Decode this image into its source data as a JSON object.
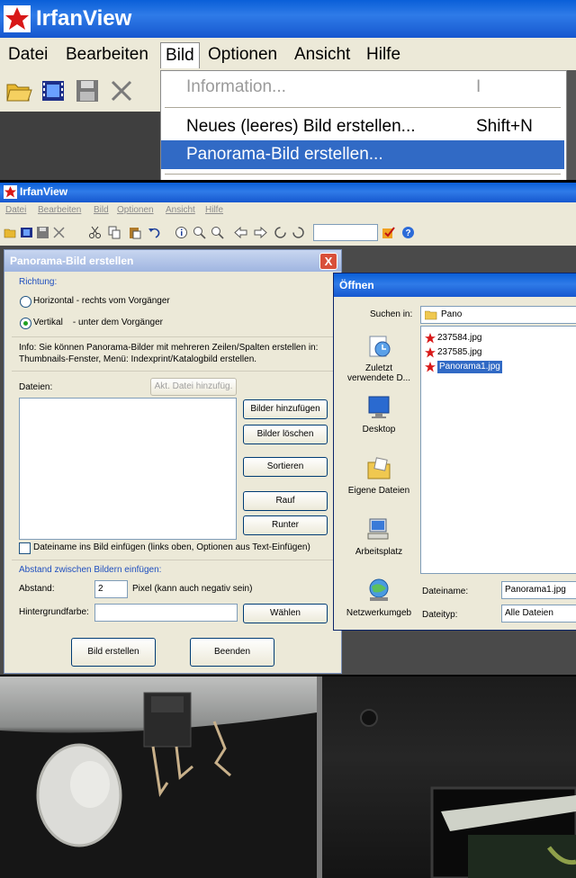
{
  "zoom_panel": {
    "app_title": "IrfanView",
    "menu": [
      "Datei",
      "Bearbeiten",
      "Bild",
      "Optionen",
      "Ansicht",
      "Hilfe"
    ],
    "dropdown": [
      {
        "label": "Information...",
        "shortcut": "I",
        "state": "disabled"
      },
      {
        "label": "Neues (leeres) Bild erstellen...",
        "shortcut": "Shift+N",
        "state": "normal"
      },
      {
        "label": "Panorama-Bild erstellen...",
        "shortcut": "",
        "state": "selected"
      }
    ]
  },
  "main_window": {
    "app_title": "IrfanView",
    "menu": [
      "Datei",
      "Bearbeiten",
      "Bild",
      "Optionen",
      "Ansicht",
      "Hilfe"
    ]
  },
  "panorama_dialog": {
    "title": "Panorama-Bild erstellen",
    "close_label": "X",
    "direction_group": "Richtung:",
    "option_horizontal": "Horizontal - rechts vom Vorgänger",
    "option_vertical": "Vertikal    - unter dem Vorgänger",
    "selected_option": "vertical",
    "info_line1": "Info: Sie können Panorama-Bilder mit mehreren Zeilen/Spalten erstellen in:",
    "info_line2": "Thumbnails-Fenster, Menü: Indexprint/Katalogbild erstellen.",
    "files_label": "Dateien:",
    "add_current_button": "Akt. Datei hinzufüg.",
    "add_images_button": "Bilder hinzufügen",
    "delete_images_button": "Bilder löschen",
    "sort_button": "Sortieren",
    "up_button": "Rauf",
    "down_button": "Runter",
    "filename_checkbox": "Dateiname ins Bild einfügen (links oben, Optionen aus Text-Einfügen)",
    "spacing_group": "Abstand zwischen Bildern einfügen:",
    "spacing_label": "Abstand:",
    "spacing_value": "2",
    "spacing_unit": "Pixel (kann auch negativ sein)",
    "bgcolor_label": "Hintergrundfarbe:",
    "bgcolor_value": "",
    "choose_button": "Wählen",
    "create_button": "Bild erstellen",
    "exit_button": "Beenden"
  },
  "open_dialog": {
    "title": "Öffnen",
    "look_in_label": "Suchen in:",
    "look_in_value": "Pano",
    "places": [
      {
        "label_line1": "Zuletzt",
        "label_line2": "verwendete D...",
        "icon": "recent-documents-icon"
      },
      {
        "label_line1": "Desktop",
        "label_line2": "",
        "icon": "desktop-icon"
      },
      {
        "label_line1": "Eigene Dateien",
        "label_line2": "",
        "icon": "my-documents-icon"
      },
      {
        "label_line1": "Arbeitsplatz",
        "label_line2": "",
        "icon": "my-computer-icon"
      },
      {
        "label_line1": "Netzwerkumgeb",
        "label_line2": "",
        "icon": "network-icon"
      }
    ],
    "files": [
      "237584.jpg",
      "237585.jpg",
      "Panorama1.jpg"
    ],
    "selected_file": "Panorama1.jpg",
    "filename_label": "Dateiname:",
    "filename_value": "Panorama1.jpg",
    "filetype_label": "Dateityp:",
    "filetype_value": "Alle Dateien"
  },
  "colors": {
    "xp_blue": "#0a5fd8",
    "selection": "#316ac5",
    "dialog_bg": "#ece9d8"
  }
}
